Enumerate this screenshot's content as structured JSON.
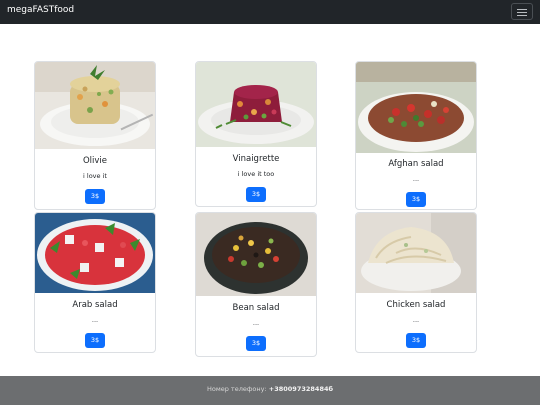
{
  "nav": {
    "brand": "megaFASTfood"
  },
  "cards": [
    {
      "title": "Olivie",
      "text": "i love it",
      "price": "3$"
    },
    {
      "title": "Vinaigrette",
      "text": "i love it too",
      "price": "3$"
    },
    {
      "title": "Afghan salad",
      "text": "...",
      "price": "3$"
    },
    {
      "title": "Arab salad",
      "text": "...",
      "price": "3$"
    },
    {
      "title": "Bean salad",
      "text": "...",
      "price": "3$"
    },
    {
      "title": "Chicken salad",
      "text": "...",
      "price": "3$"
    }
  ],
  "footer": {
    "phone_label": "Номер телефону:",
    "phone_number": "+380097328484б",
    "line2": ""
  },
  "colors": {
    "navbar": "#212529",
    "button": "#0d6efd",
    "footer": "#6c6e70"
  }
}
